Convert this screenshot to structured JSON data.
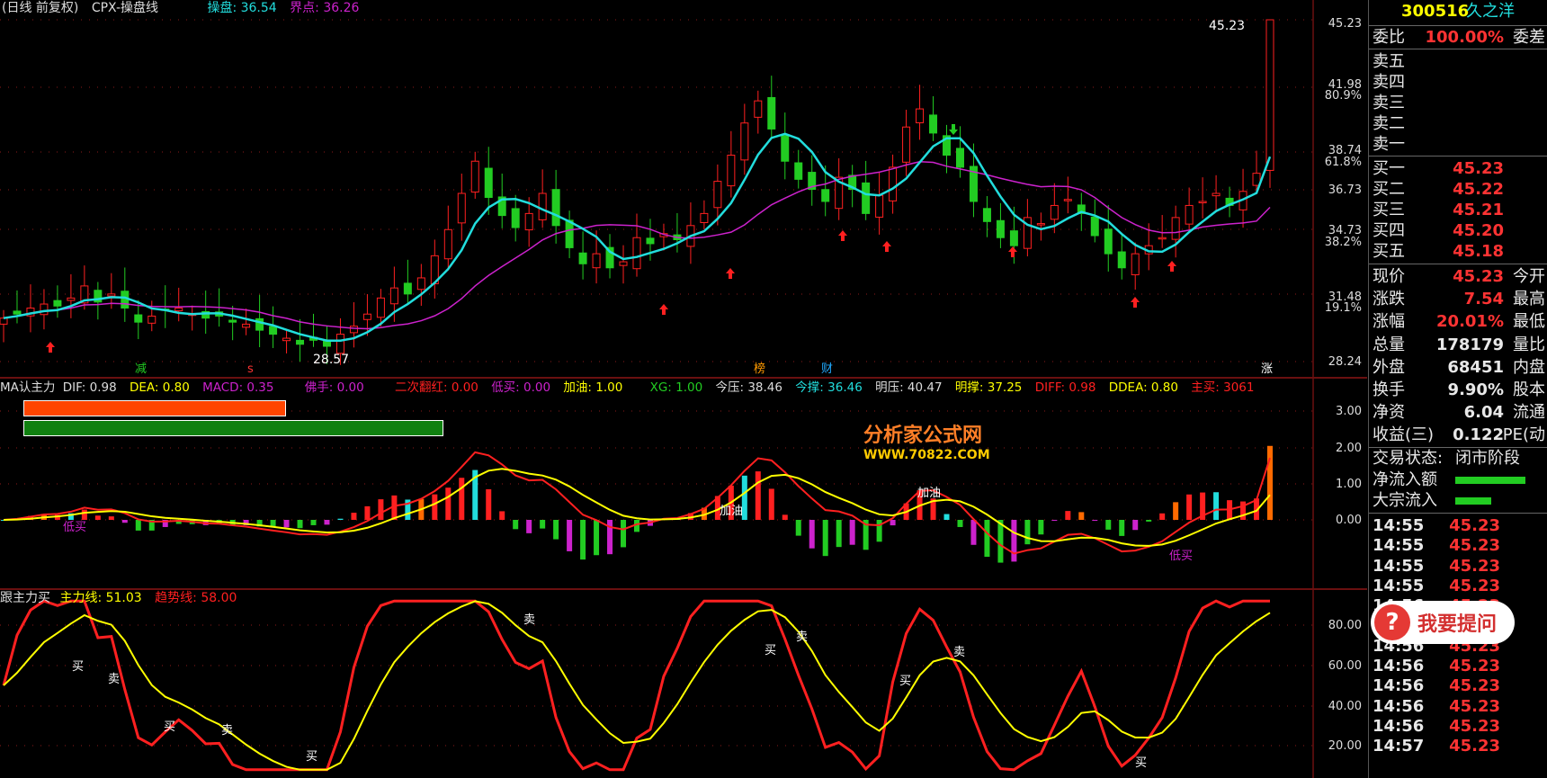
{
  "header1": {
    "title": "(日线 前复权)",
    "formula": "CPX-操盘线",
    "caopan": "操盘: 36.54",
    "jiedian": "界点: 36.26"
  },
  "header2": {
    "name": "MA认主力",
    "dif": "DIF: 0.98",
    "dea": "DEA: 0.80",
    "macd": "MACD: 0.35",
    "foshou": "佛手: 0.00",
    "erci": "二次翻红: 0.00",
    "dimai": "低买: 0.00",
    "jiayou": "加油: 1.00",
    "xg": "XG: 1.00",
    "jinya": "今压: 38.46",
    "jincheng": "今撑: 36.46",
    "mingya": "明压: 40.47",
    "mingcheng": "明撑: 37.25",
    "diff": "DIFF: 0.98",
    "ddea": "DDEA: 0.80",
    "zhumai": "主买: 3061"
  },
  "header3": {
    "name": "跟主力买",
    "zhuli": "主力线: 51.03",
    "qushi": "趋势线: 58.00"
  },
  "price_axis": [
    "45.23",
    "41.98",
    "80.9%",
    "38.74",
    "61.8%",
    "36.73",
    "34.73",
    "38.2%",
    "31.48",
    "19.1%",
    "28.24"
  ],
  "macd_axis": [
    "3.00",
    "2.00",
    "1.00",
    "0.00"
  ],
  "kdj_axis": [
    "80.00",
    "60.00",
    "40.00",
    "20.00"
  ],
  "annotations": {
    "high": "45.23",
    "low": "28.57",
    "jian": "减",
    "zhang": "涨",
    "bang": "榜",
    "cai": "财",
    "s": "s",
    "jiayou": "加油",
    "dimai": "低买",
    "mai": "买",
    "sell": "卖"
  },
  "colors": {
    "up": "#ff2020",
    "down": "#22cc22",
    "ma_fast": "#22dddd",
    "ma_slow": "#cc22cc",
    "yellow": "#ffff00",
    "accent": "#ff3333"
  },
  "chart_data": {
    "type": "candlestick",
    "y_range": [
      28.24,
      45.23
    ],
    "last_close": 45.23,
    "closes": [
      30.4,
      30.6,
      30.9,
      31.1,
      31.0,
      31.4,
      32.0,
      31.2,
      31.6,
      30.9,
      30.2,
      30.5,
      30.8,
      30.9,
      30.6,
      30.4,
      30.5,
      30.2,
      30.1,
      29.8,
      29.6,
      29.4,
      29.1,
      29.3,
      29.0,
      29.6,
      30.0,
      30.6,
      31.4,
      31.9,
      31.6,
      32.4,
      33.5,
      34.8,
      36.6,
      38.2,
      36.4,
      35.5,
      34.9,
      35.6,
      36.6,
      35.0,
      33.9,
      33.1,
      33.6,
      32.9,
      33.2,
      34.4,
      34.1,
      34.6,
      34.3,
      35.0,
      35.6,
      37.2,
      38.5,
      40.1,
      41.2,
      39.8,
      38.2,
      37.3,
      36.8,
      36.2,
      37.4,
      36.8,
      35.6,
      36.5,
      37.9,
      39.9,
      40.8,
      39.6,
      38.5,
      37.9,
      36.2,
      35.2,
      34.4,
      34.0,
      35.4,
      35.1,
      36.0,
      36.3,
      35.6,
      34.5,
      33.6,
      32.9,
      33.6,
      34.0,
      34.4,
      35.4,
      36.0,
      36.2,
      36.6,
      36.0,
      36.7,
      37.6,
      45.23
    ],
    "ma_fast": "computed",
    "ma_slow": "computed"
  },
  "quote": {
    "code": "300516",
    "name": "久之洋",
    "weibi_k": "委比",
    "weibi_v": "100.00%",
    "weicha": "委差",
    "sell": [
      "卖五",
      "卖四",
      "卖三",
      "卖二",
      "卖一"
    ],
    "buy": [
      {
        "k": "买一",
        "v": "45.23"
      },
      {
        "k": "买二",
        "v": "45.22"
      },
      {
        "k": "买三",
        "v": "45.21"
      },
      {
        "k": "买四",
        "v": "45.20"
      },
      {
        "k": "买五",
        "v": "45.18"
      }
    ],
    "stats": [
      {
        "k": "现价",
        "v": "45.23",
        "k2": "今开"
      },
      {
        "k": "涨跌",
        "v": "7.54",
        "k2": "最高"
      },
      {
        "k": "涨幅",
        "v": "20.01%",
        "k2": "最低"
      },
      {
        "k": "总量",
        "v": "178179",
        "k2": "量比"
      },
      {
        "k": "外盘",
        "v": "68451",
        "k2": "内盘"
      },
      {
        "k": "换手",
        "v": "9.90%",
        "k2": "股本"
      },
      {
        "k": "净资",
        "v": "6.04",
        "k2": "流通"
      },
      {
        "k": "收益(三)",
        "v": "0.122",
        "k2": "PE(动"
      }
    ],
    "status_k": "交易状态:",
    "status_v": "闭市阶段",
    "jlr": "净流入额",
    "dzlr": "大宗流入",
    "ticks": [
      {
        "t": "14:55",
        "p": "45.23"
      },
      {
        "t": "14:55",
        "p": "45.23"
      },
      {
        "t": "14:55",
        "p": "45.23"
      },
      {
        "t": "14:55",
        "p": "45.23"
      },
      {
        "t": "14:56",
        "p": "45.23"
      },
      {
        "t": "14:56",
        "p": "45.23"
      },
      {
        "t": "14:56",
        "p": "45.23"
      },
      {
        "t": "14:56",
        "p": "45.23"
      },
      {
        "t": "14:56",
        "p": "45.23"
      },
      {
        "t": "14:56",
        "p": "45.23"
      },
      {
        "t": "14:56",
        "p": "45.23"
      },
      {
        "t": "14:57",
        "p": "45.23"
      }
    ]
  },
  "badge": {
    "q": "?",
    "text": "我要提问"
  },
  "watermark": {
    "name": "分析家公式网",
    "url": "WWW.70822.COM"
  }
}
